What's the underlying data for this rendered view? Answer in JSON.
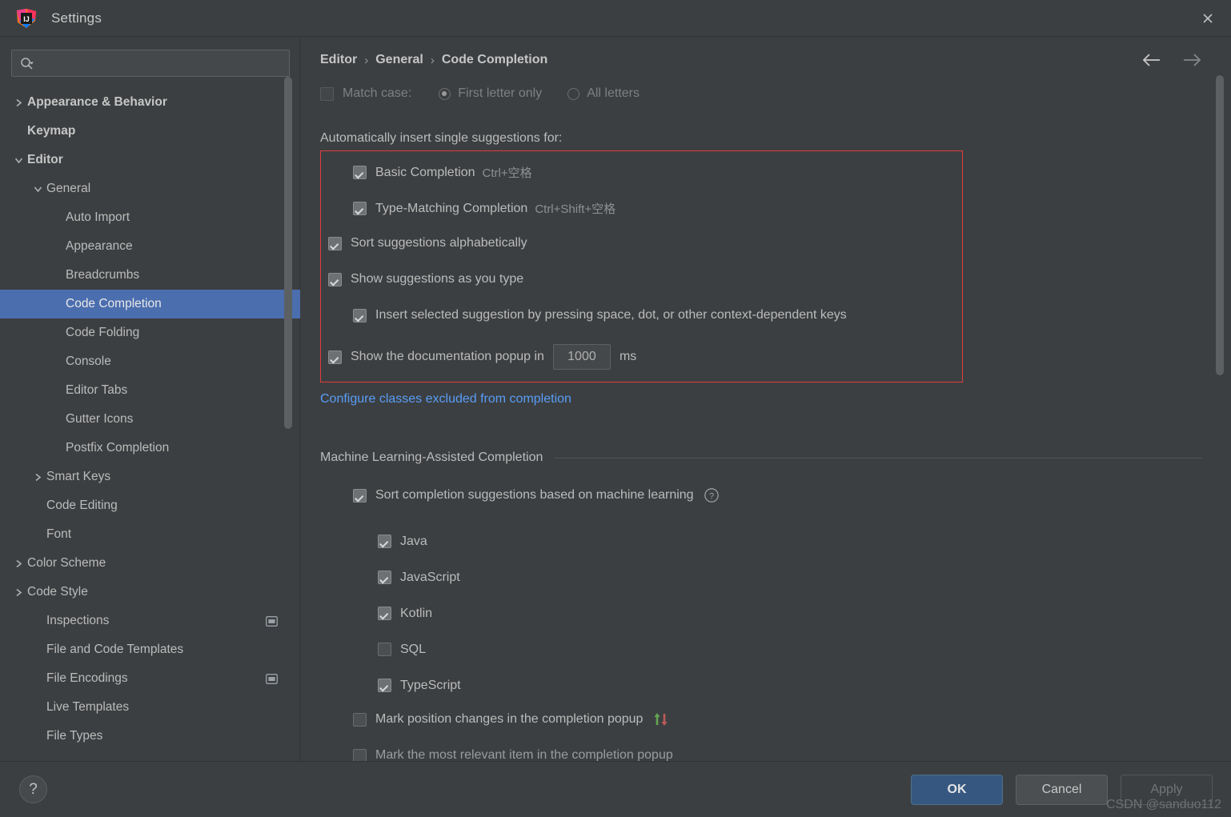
{
  "window": {
    "title": "Settings",
    "logo_icon": "intellij-idea-logo",
    "close_icon": "close-icon"
  },
  "search": {
    "value": "",
    "placeholder": "",
    "icon": "search-icon",
    "dropdown_icon": "chevron-down-icon"
  },
  "sidebar": {
    "items": [
      {
        "label": "Appearance & Behavior",
        "indent": 0,
        "arrow": "collapsed",
        "bold": true,
        "selected": false,
        "badge": false
      },
      {
        "label": "Keymap",
        "indent": 0,
        "arrow": "none",
        "bold": true,
        "selected": false,
        "badge": false
      },
      {
        "label": "Editor",
        "indent": 0,
        "arrow": "expanded",
        "bold": true,
        "selected": false,
        "badge": false
      },
      {
        "label": "General",
        "indent": 1,
        "arrow": "expanded",
        "bold": false,
        "selected": false,
        "badge": false
      },
      {
        "label": "Auto Import",
        "indent": 2,
        "arrow": "none",
        "bold": false,
        "selected": false,
        "badge": false
      },
      {
        "label": "Appearance",
        "indent": 2,
        "arrow": "none",
        "bold": false,
        "selected": false,
        "badge": false
      },
      {
        "label": "Breadcrumbs",
        "indent": 2,
        "arrow": "none",
        "bold": false,
        "selected": false,
        "badge": false
      },
      {
        "label": "Code Completion",
        "indent": 2,
        "arrow": "none",
        "bold": false,
        "selected": true,
        "badge": false
      },
      {
        "label": "Code Folding",
        "indent": 2,
        "arrow": "none",
        "bold": false,
        "selected": false,
        "badge": false
      },
      {
        "label": "Console",
        "indent": 2,
        "arrow": "none",
        "bold": false,
        "selected": false,
        "badge": false
      },
      {
        "label": "Editor Tabs",
        "indent": 2,
        "arrow": "none",
        "bold": false,
        "selected": false,
        "badge": false
      },
      {
        "label": "Gutter Icons",
        "indent": 2,
        "arrow": "none",
        "bold": false,
        "selected": false,
        "badge": false
      },
      {
        "label": "Postfix Completion",
        "indent": 2,
        "arrow": "none",
        "bold": false,
        "selected": false,
        "badge": false
      },
      {
        "label": "Smart Keys",
        "indent": 1,
        "arrow": "collapsed",
        "bold": false,
        "selected": false,
        "badge": false
      },
      {
        "label": "Code Editing",
        "indent": 1,
        "arrow": "none",
        "bold": false,
        "selected": false,
        "badge": false
      },
      {
        "label": "Font",
        "indent": 1,
        "arrow": "none",
        "bold": false,
        "selected": false,
        "badge": false
      },
      {
        "label": "Color Scheme",
        "indent": 0,
        "arrow": "collapsed",
        "bold": false,
        "selected": false,
        "badge": false
      },
      {
        "label": "Code Style",
        "indent": 0,
        "arrow": "collapsed",
        "bold": false,
        "selected": false,
        "badge": false
      },
      {
        "label": "Inspections",
        "indent": 1,
        "arrow": "none",
        "bold": false,
        "selected": false,
        "badge": true
      },
      {
        "label": "File and Code Templates",
        "indent": 1,
        "arrow": "none",
        "bold": false,
        "selected": false,
        "badge": false
      },
      {
        "label": "File Encodings",
        "indent": 1,
        "arrow": "none",
        "bold": false,
        "selected": false,
        "badge": true
      },
      {
        "label": "Live Templates",
        "indent": 1,
        "arrow": "none",
        "bold": false,
        "selected": false,
        "badge": false
      },
      {
        "label": "File Types",
        "indent": 1,
        "arrow": "none",
        "bold": false,
        "selected": false,
        "badge": false
      }
    ]
  },
  "main": {
    "breadcrumb": [
      "Editor",
      "General",
      "Code Completion"
    ],
    "breadcrumb_separator": "›",
    "nav": {
      "back_icon": "arrow-left-icon",
      "forward_icon": "arrow-right-icon"
    },
    "match_case": {
      "label": "Match case:",
      "checked": false,
      "options": [
        {
          "label": "First letter only",
          "selected": true
        },
        {
          "label": "All letters",
          "selected": false
        }
      ]
    },
    "auto_insert_label": "Automatically insert single suggestions for:",
    "options": {
      "basic_completion": {
        "label": "Basic Completion",
        "shortcut": "Ctrl+空格",
        "checked": true
      },
      "type_matching": {
        "label": "Type-Matching Completion",
        "shortcut": "Ctrl+Shift+空格",
        "checked": true
      },
      "sort_alpha": {
        "label": "Sort suggestions alphabetically",
        "checked": true
      },
      "show_as_you_type": {
        "label": "Show suggestions as you type",
        "checked": true
      },
      "insert_selected": {
        "label": "Insert selected suggestion by pressing space, dot, or other context-dependent keys",
        "checked": true
      },
      "show_doc_popup": {
        "label": "Show the documentation popup in",
        "checked": true,
        "delay_value": "1000",
        "unit": "ms"
      }
    },
    "excluded_link": "Configure classes excluded from completion",
    "ml_section": {
      "title": "Machine Learning-Assisted Completion",
      "sort_ml": {
        "label": "Sort completion suggestions based on machine learning",
        "checked": true,
        "help_icon": "help-circle-icon"
      },
      "languages": [
        {
          "label": "Java",
          "checked": true
        },
        {
          "label": "JavaScript",
          "checked": true
        },
        {
          "label": "Kotlin",
          "checked": true
        },
        {
          "label": "SQL",
          "checked": false
        },
        {
          "label": "TypeScript",
          "checked": true
        }
      ],
      "mark_position": {
        "label": "Mark position changes in the completion popup",
        "checked": false,
        "icon": "up-down-arrows-icon"
      },
      "mark_relevant": {
        "label": "Mark the most relevant item in the completion popup",
        "checked": false
      }
    },
    "annotation_box_color": "#e03c3c"
  },
  "footer": {
    "help_label": "?",
    "buttons": [
      {
        "label": "OK",
        "style": "primary",
        "enabled": true
      },
      {
        "label": "Cancel",
        "style": "default",
        "enabled": true
      },
      {
        "label": "Apply",
        "style": "disabled",
        "enabled": false
      }
    ],
    "watermark": "CSDN @sanduo112"
  },
  "colors": {
    "background": "#3c3f41",
    "selection": "#4b6eaf",
    "link": "#589df6",
    "accent_ok": "#365880",
    "annotation": "#e03c3c",
    "arrow_up_green": "#62a550",
    "arrow_down_red": "#bb5a5a"
  }
}
